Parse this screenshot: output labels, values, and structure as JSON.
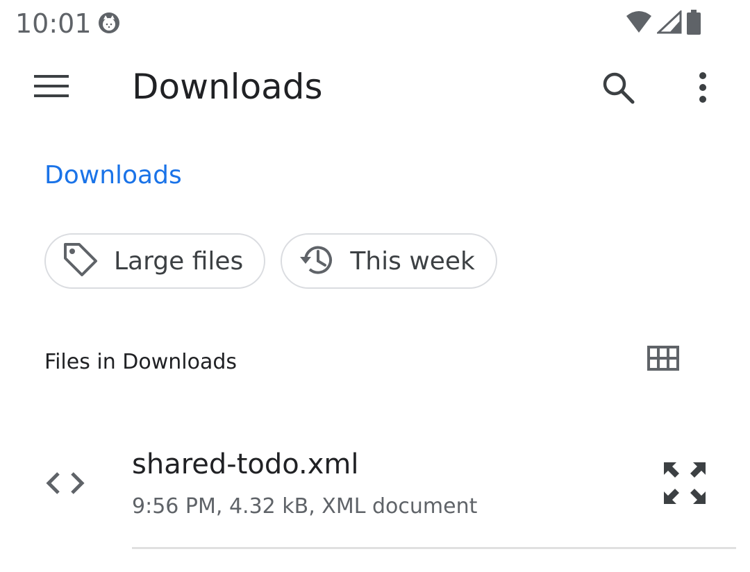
{
  "status_bar": {
    "time": "10:01",
    "icons": [
      "app-notification-icon",
      "wifi-icon",
      "cell-signal-icon",
      "battery-icon"
    ]
  },
  "app_bar": {
    "title": "Downloads",
    "icons": [
      "menu-icon",
      "search-icon",
      "more-vert-icon"
    ]
  },
  "breadcrumb": {
    "label": "Downloads"
  },
  "chips": [
    {
      "label": "Large files",
      "icon": "tag-icon"
    },
    {
      "label": "This week",
      "icon": "history-icon"
    }
  ],
  "section": {
    "header": "Files in Downloads",
    "toggle_icon": "grid-view-icon"
  },
  "files": [
    {
      "name": "shared-todo.xml",
      "meta": "9:56 PM, 4.32 kB, XML document",
      "icon": "code-icon",
      "action_icon": "expand-icon"
    }
  ],
  "colors": {
    "accent": "#1a73e8",
    "primary_text": "#202124",
    "secondary_text": "#5f6368",
    "chip_border": "#dadce0",
    "icon": "#5f6368"
  }
}
